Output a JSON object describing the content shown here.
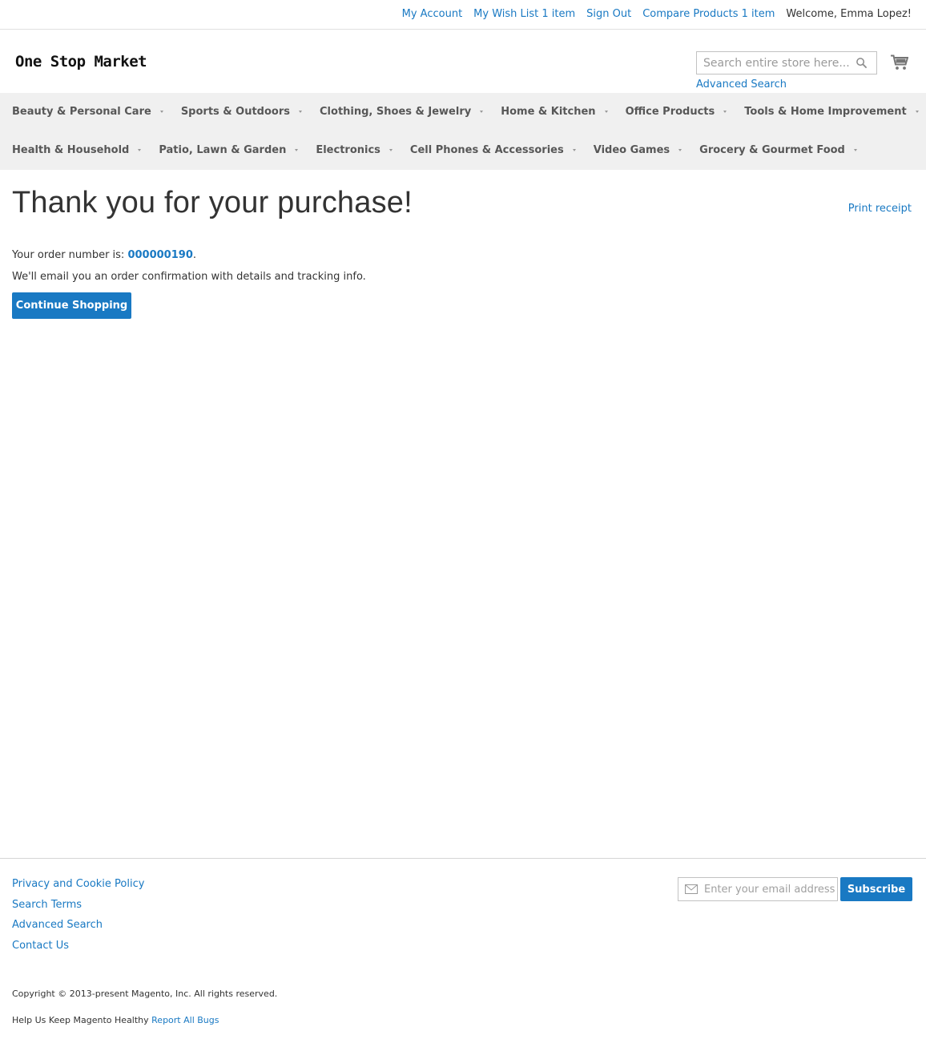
{
  "header_links": {
    "my_account": "My Account",
    "wish_list": "My Wish List 1 item",
    "sign_out": "Sign Out",
    "compare": "Compare Products 1 item",
    "welcome": "Welcome, Emma Lopez!"
  },
  "store": {
    "logo": "One Stop Market"
  },
  "search": {
    "placeholder": "Search entire store here...",
    "advanced_link": "Advanced Search"
  },
  "nav": {
    "row1": [
      {
        "label": "Beauty & Personal Care"
      },
      {
        "label": "Sports & Outdoors"
      },
      {
        "label": "Clothing, Shoes & Jewelry"
      },
      {
        "label": "Home & Kitchen"
      },
      {
        "label": "Office Products"
      },
      {
        "label": "Tools & Home Improvement"
      }
    ],
    "row2": [
      {
        "label": "Health & Household"
      },
      {
        "label": "Patio, Lawn & Garden"
      },
      {
        "label": "Electronics"
      },
      {
        "label": "Cell Phones & Accessories"
      },
      {
        "label": "Video Games"
      },
      {
        "label": "Grocery & Gourmet Food"
      }
    ]
  },
  "main": {
    "title": "Thank you for your purchase!",
    "print_receipt": "Print receipt",
    "order_prefix": "Your order number is: ",
    "order_number": "000000190",
    "order_suffix": ".",
    "email_message": "We'll email you an order confirmation with details and tracking info.",
    "continue_button": "Continue Shopping"
  },
  "footer": {
    "links": [
      {
        "label": "Privacy and Cookie Policy"
      },
      {
        "label": "Search Terms"
      },
      {
        "label": "Advanced Search"
      },
      {
        "label": "Contact Us"
      }
    ],
    "newsletter_placeholder": "Enter your email address",
    "subscribe_button": "Subscribe",
    "copyright": "Copyright © 2013-present Magento, Inc. All rights reserved.",
    "help_text": "Help Us Keep Magento Healthy ",
    "report_bugs": "Report All Bugs"
  },
  "colors": {
    "link": "#1979c3",
    "nav_background": "#f0f0f0",
    "button": "#1979c3"
  },
  "icons": {
    "search": "search-icon",
    "cart": "cart-icon",
    "mail": "mail-icon",
    "caret": "chevron-down-icon"
  }
}
